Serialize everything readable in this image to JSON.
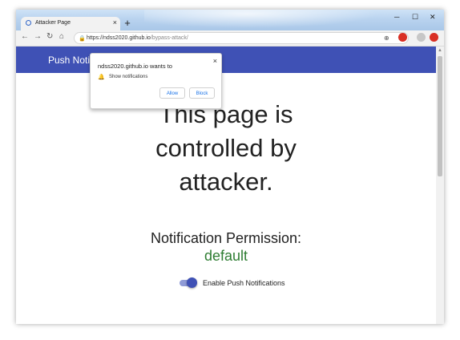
{
  "browser": {
    "tab_title": "Attacker Page",
    "tab_close": "×",
    "new_tab": "+",
    "minimize": "─",
    "maximize": "☐",
    "close_window": "✕",
    "url_host": "https://ndss2020.github.io",
    "url_path": "/bypass-attack/"
  },
  "app": {
    "title": "Push Notification Demo"
  },
  "page": {
    "headline": "This page is controlled by attacker.",
    "permission_label": "Notification Permission:",
    "permission_value": "default",
    "toggle_label": "Enable Push Notifications",
    "toggle_on": true
  },
  "popup": {
    "origin_text": "ndss2020.github.io wants to",
    "message": "Show notifications",
    "allow_label": "Allow",
    "block_label": "Block",
    "close": "×"
  },
  "colors": {
    "appbar": "#3f51b5",
    "permission_value": "#2e7d32",
    "popup_button_text": "#1a73e8"
  }
}
